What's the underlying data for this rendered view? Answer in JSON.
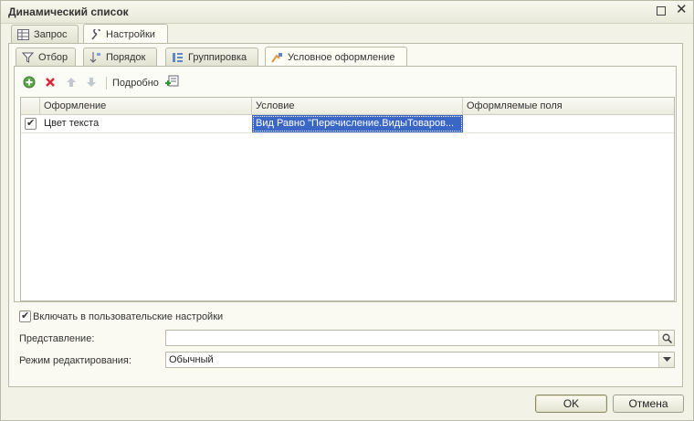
{
  "window": {
    "title": "Динамический список"
  },
  "top_tabs": [
    {
      "label": "Запрос"
    },
    {
      "label": "Настройки"
    }
  ],
  "sub_tabs": [
    {
      "label": "Отбор"
    },
    {
      "label": "Порядок"
    },
    {
      "label": "Группировка"
    },
    {
      "label": "Условное оформление"
    }
  ],
  "toolbar": {
    "details_label": "Подробно"
  },
  "grid": {
    "columns": [
      "Оформление",
      "Условие",
      "Оформляемые поля"
    ],
    "rows": [
      {
        "checked": true,
        "appearance": "Цвет текста",
        "condition": "Вид Равно \"Перечисление.ВидыТоваров...",
        "fields": ""
      }
    ]
  },
  "form": {
    "include_label": "Включать в пользовательские настройки",
    "presentation_label": "Представление:",
    "presentation_value": "",
    "edit_mode_label": "Режим редактирования:",
    "edit_mode_value": "Обычный"
  },
  "buttons": {
    "ok": "OK",
    "cancel": "Отмена"
  },
  "colors": {
    "selection": "#3a66c6",
    "window_bg": "#f2f2e6"
  }
}
